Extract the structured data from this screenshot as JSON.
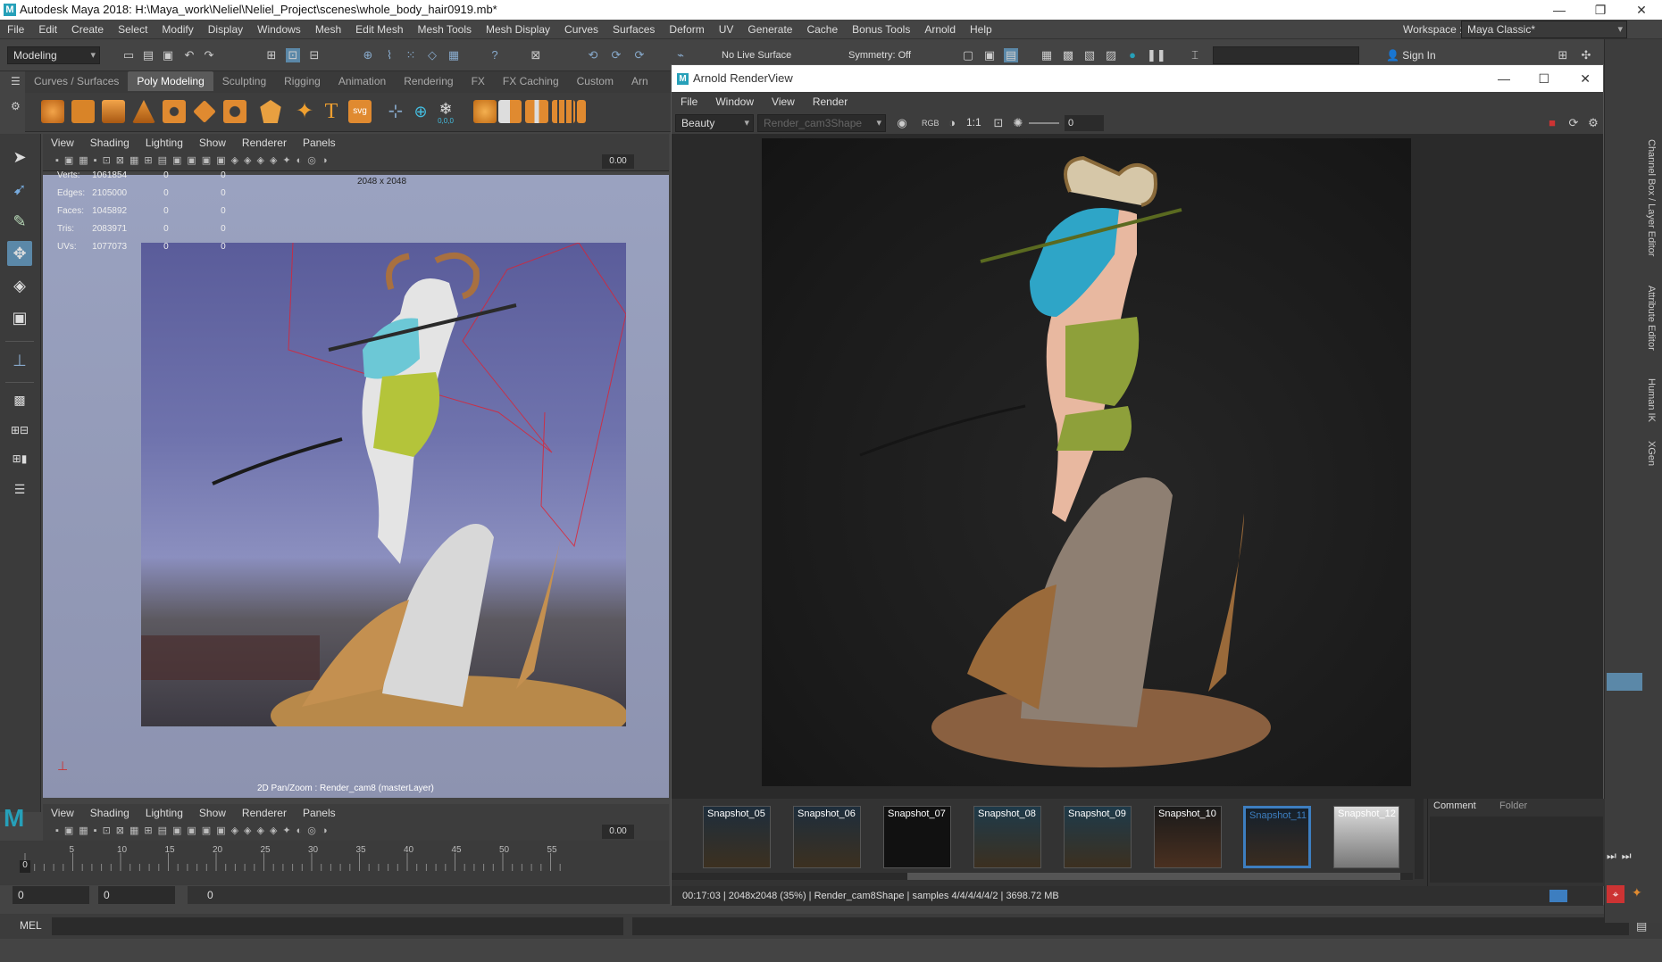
{
  "window": {
    "title": "Autodesk Maya 2018: H:\\Maya_work\\Neliel\\Neliel_Project\\scenes\\whole_body_hair0919.mb*",
    "logo": "M"
  },
  "menubar": [
    "File",
    "Edit",
    "Create",
    "Select",
    "Modify",
    "Display",
    "Windows",
    "Mesh",
    "Edit Mesh",
    "Mesh Tools",
    "Mesh Display",
    "Curves",
    "Surfaces",
    "Deform",
    "UV",
    "Generate",
    "Cache",
    "Bonus Tools",
    "Arnold",
    "Help"
  ],
  "statusline": {
    "mode": "Modeling",
    "live_surface": "No Live Surface",
    "symmetry": "Symmetry: Off",
    "sign_in": "Sign In",
    "workspace_label": "Workspace :",
    "workspace_value": "Maya Classic*"
  },
  "shelf": {
    "tabs": [
      "Curves / Surfaces",
      "Poly Modeling",
      "Sculpting",
      "Rigging",
      "Animation",
      "Rendering",
      "FX",
      "FX Caching",
      "Custom",
      "Arn"
    ],
    "active_tab": "Poly Modeling",
    "svg_label": "svg",
    "text_label": "T",
    "coords": "0,0,0"
  },
  "panel_menu": [
    "View",
    "Shading",
    "Lighting",
    "Show",
    "Renderer",
    "Panels"
  ],
  "panel_toolbar_value": "0.00",
  "hud": {
    "resolution": "2048 x 2048",
    "rows": [
      {
        "label": "Verts:",
        "a": "1061854",
        "b": "0",
        "c": "0"
      },
      {
        "label": "Edges:",
        "a": "2105000",
        "b": "0",
        "c": "0"
      },
      {
        "label": "Faces:",
        "a": "1045892",
        "b": "0",
        "c": "0"
      },
      {
        "label": "Tris:",
        "a": "2083971",
        "b": "0",
        "c": "0"
      },
      {
        "label": "UVs:",
        "a": "1077073",
        "b": "0",
        "c": "0"
      }
    ],
    "camera_label": "2D Pan/Zoom : Render_cam8 (masterLayer)"
  },
  "arnold": {
    "title": "Arnold RenderView",
    "menu": [
      "File",
      "Window",
      "View",
      "Render"
    ],
    "aov": "Beauty",
    "camera": "Render_cam3Shape",
    "ratio": "1:1",
    "exposure": "0",
    "snapshots": [
      "Snapshot_05",
      "Snapshot_06",
      "Snapshot_07",
      "Snapshot_08",
      "Snapshot_09",
      "Snapshot_10",
      "Snapshot_11",
      "Snapshot_12"
    ],
    "selected_snapshot": "Snapshot_11",
    "side_tabs": [
      "Comment",
      "Folder"
    ],
    "status": "00:17:03 | 2048x2048 (35%) | Render_cam8Shape | samples 4/4/4/4/4/2 | 3698.72 MB"
  },
  "timeline": {
    "ticks": [
      "5",
      "10",
      "15",
      "20",
      "25",
      "30",
      "35",
      "40",
      "45",
      "50",
      "55"
    ],
    "current": "0"
  },
  "range": {
    "start": "0",
    "inner": "0",
    "slider": "0"
  },
  "cmdline": {
    "label": "MEL"
  },
  "right_tabs": [
    "Channel Box / Layer Editor",
    "Attribute Editor",
    "Human IK",
    "XGen"
  ],
  "colors": {
    "maya_blue": "#26a0b9",
    "accent": "#5b88a8",
    "selection": "#3d7ec0"
  }
}
